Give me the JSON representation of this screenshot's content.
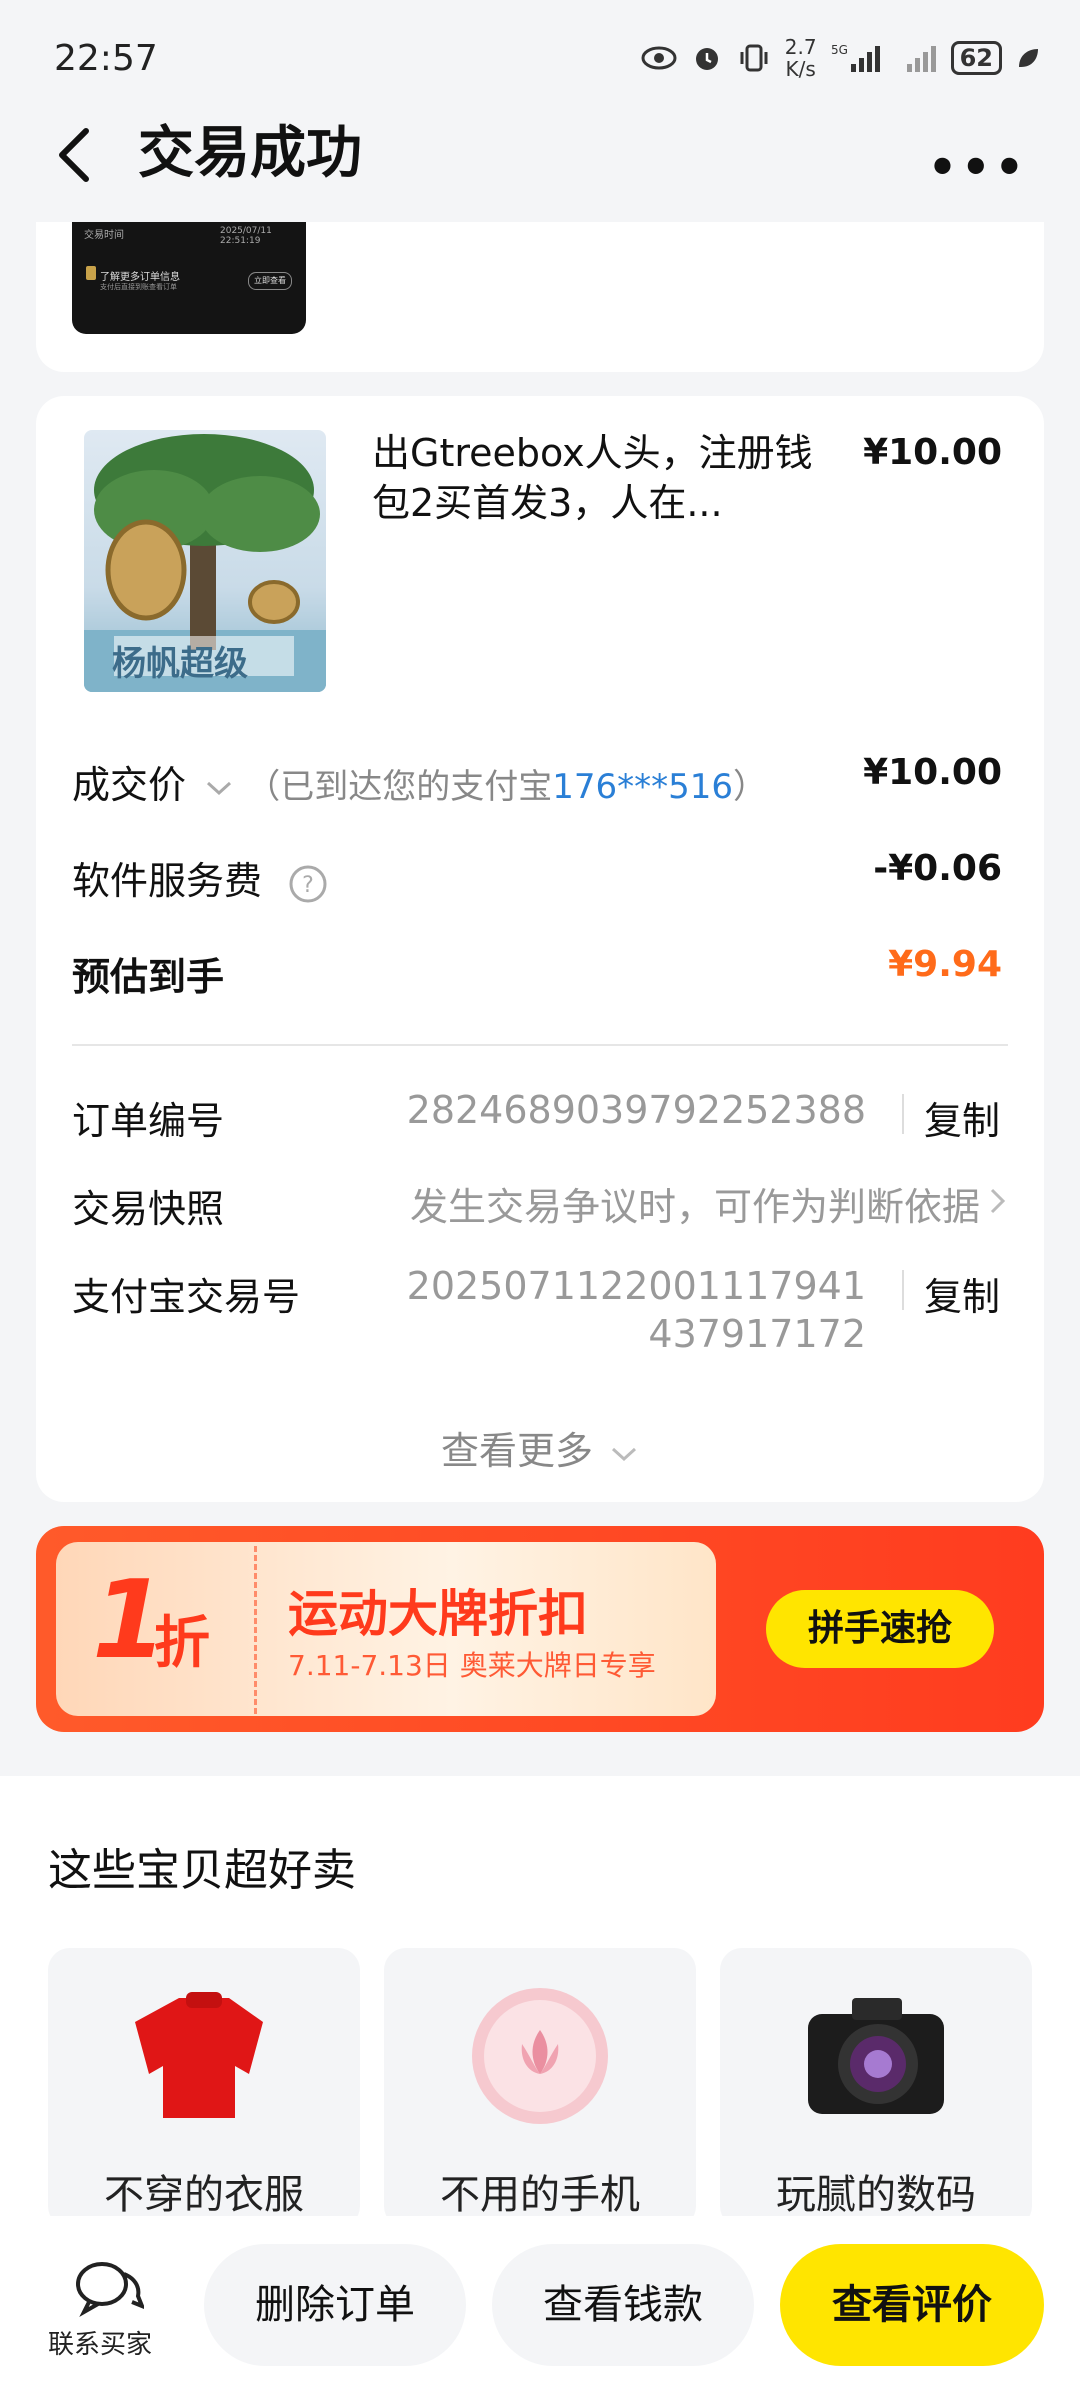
{
  "status_bar": {
    "time": "22:57",
    "net_speed_top": "2.7",
    "net_speed_bottom": "K/s",
    "signal": "5G",
    "battery": "62",
    "icons": [
      "eye-icon",
      "alarm-icon",
      "vibrate-icon",
      "signal-icon",
      "battery-icon",
      "leaf-icon"
    ]
  },
  "header": {
    "title": "交易成功",
    "more": "•••"
  },
  "snapshot": {
    "time_label": "交易时间",
    "time_value": "2025/07/11 22:51:19",
    "info": "了解更多订单信息",
    "info_sub": "支付后直接到账查看订单",
    "button": "立即查看"
  },
  "product": {
    "title": "出Gtreebox人头，注册钱包2买首发3，人在...",
    "price": "¥10.00",
    "image_caption": "杨帆超级"
  },
  "summary": {
    "deal_price_label": "成交价",
    "deal_price_note_prefix": "（已到达您的支付宝",
    "deal_price_account": "176***516",
    "deal_price_note_suffix": "）",
    "deal_price_value": "¥10.00",
    "fee_label": "软件服务费",
    "fee_value": "-¥0.06",
    "net_label": "预估到手",
    "net_value": "¥9.94"
  },
  "order": {
    "order_no_label": "订单编号",
    "order_no": "2824689039792252388",
    "copy": "复制",
    "snapshot_label": "交易快照",
    "snapshot_text": "发生交易争议时，可作为判断依据",
    "alipay_label": "支付宝交易号",
    "alipay_no_line1": "2025071122001117941",
    "alipay_no_line2": "437917172",
    "view_more": "查看更多"
  },
  "banner": {
    "discount_num": "1",
    "discount_unit": "折",
    "headline": "运动大牌折扣",
    "subline": "7.11-7.13日 奥莱大牌日专享",
    "cta": "拼手速抢"
  },
  "recommend": {
    "title": "这些宝贝超好卖",
    "tiles": [
      {
        "label": "不穿的衣服"
      },
      {
        "label": "不用的手机"
      },
      {
        "label": "玩腻的数码"
      }
    ]
  },
  "bottom_bar": {
    "contact": "联系买家",
    "delete": "删除订单",
    "view_money": "查看钱款",
    "view_review": "查看评价"
  },
  "colors": {
    "accent_yellow": "#ffe500",
    "price_orange": "#ff6b1a",
    "link_blue": "#2a7fd6",
    "banner_red": "#ff3c1f"
  }
}
